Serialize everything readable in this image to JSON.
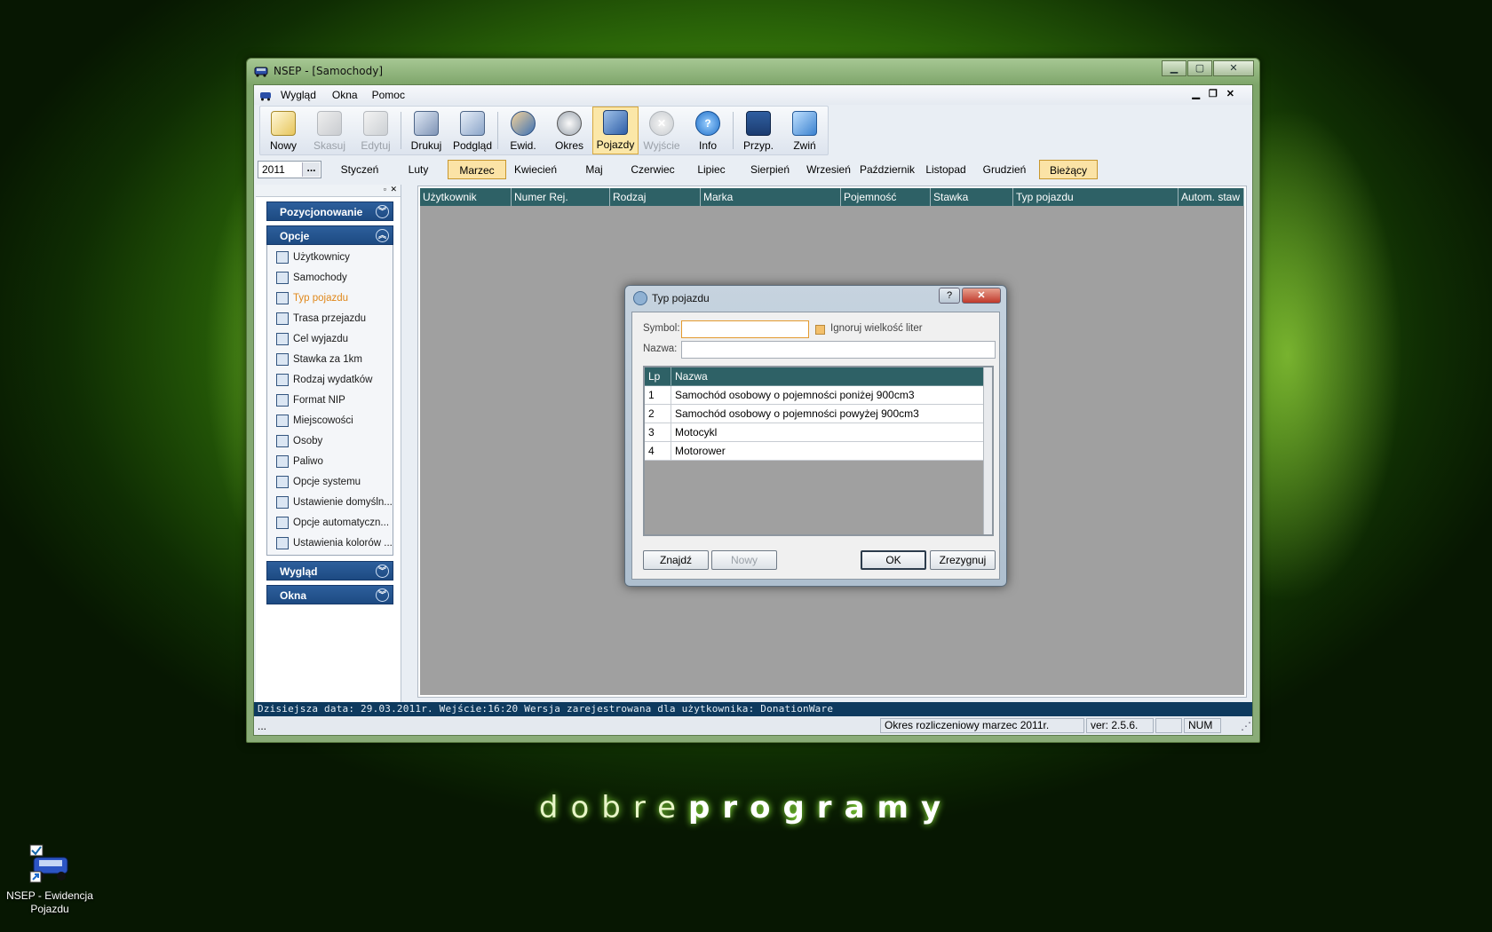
{
  "window": {
    "title": "NSEP - [Samochody]",
    "min": "▁",
    "max": "▢",
    "close": "✕"
  },
  "menu": {
    "items": [
      "Wygląd",
      "Okna",
      "Pomoc"
    ],
    "mdi_min": "▁",
    "mdi_restore": "❐",
    "mdi_close": "✕"
  },
  "toolbar": [
    {
      "label": "Nowy",
      "icon": "new-icon",
      "enabled": true
    },
    {
      "label": "Skasuj",
      "icon": "delete-icon",
      "enabled": false
    },
    {
      "label": "Edytuj",
      "icon": "edit-icon",
      "enabled": false
    },
    {
      "label": "Drukuj",
      "icon": "print-icon",
      "enabled": true
    },
    {
      "label": "Podgląd",
      "icon": "preview-icon",
      "enabled": true
    },
    {
      "label": "Ewid.",
      "icon": "users-icon",
      "enabled": true
    },
    {
      "label": "Okres",
      "icon": "clock-icon",
      "enabled": true
    },
    {
      "label": "Pojazdy",
      "icon": "vehicle-icon",
      "enabled": true,
      "active": true
    },
    {
      "label": "Wyjście",
      "icon": "exit-icon",
      "enabled": false
    },
    {
      "label": "Info",
      "icon": "info-icon",
      "enabled": true
    },
    {
      "label": "Przyp.",
      "icon": "reminder-icon",
      "enabled": true
    },
    {
      "label": "Zwiń",
      "icon": "collapse-icon",
      "enabled": true
    }
  ],
  "period": {
    "year": "2011",
    "browse": "...",
    "months": [
      "Styczeń",
      "Luty",
      "Marzec",
      "Kwiecień",
      "Maj",
      "Czerwiec",
      "Lipiec",
      "Sierpień",
      "Wrzesień",
      "Październik",
      "Listopad",
      "Grudzień"
    ],
    "selected_month": "Marzec",
    "current_label": "Bieżący"
  },
  "sidebar": {
    "pin": "▫",
    "close": "✕",
    "groups": {
      "positioning": "Pozycjonowanie",
      "options": "Opcje",
      "view": "Wygląd",
      "windows": "Okna"
    },
    "items": [
      "Użytkownicy",
      "Samochody",
      "Typ pojazdu",
      "Trasa przejazdu",
      "Cel wyjazdu",
      "Stawka za 1km",
      "Rodzaj wydatków",
      "Format NIP",
      "Miejscowości",
      "Osoby",
      "Paliwo",
      "Opcje systemu",
      "Ustawienie domyśln...",
      "Opcje automatyczn...",
      "Ustawienia kolorów ..."
    ],
    "current_item": "Typ pojazdu"
  },
  "grid": {
    "columns": [
      "Użytkownik",
      "Numer Rej.",
      "Rodzaj",
      "Marka",
      "Pojemność",
      "Stawka",
      "Typ pojazdu",
      "Autom. staw"
    ]
  },
  "infobar": {
    "text": "Dzisiejsza data: 29.03.2011r.  Wejście:16:20  Wersja zarejestrowana dla użytkownika: DonationWare"
  },
  "statusbar": {
    "left": "...",
    "period": "Okres rozliczeniowy marzec 2011r.",
    "version": "ver: 2.5.6.",
    "num": "NUM",
    "grip": "⋰"
  },
  "dialog": {
    "title": "Typ pojazdu",
    "help": "?",
    "close": "✕",
    "symbol_label": "Symbol:",
    "symbol_value": "",
    "ignore_case_label": "Ignoruj wielkość liter",
    "ignore_case_checked": true,
    "name_label": "Nazwa:",
    "name_value": "",
    "table": {
      "headers": [
        "Lp",
        "Nazwa"
      ],
      "rows": [
        [
          "1",
          "Samochód osobowy o pojemności poniżej 900cm3"
        ],
        [
          "2",
          "Samochód osobowy o pojemności powyżej 900cm3"
        ],
        [
          "3",
          "Motocykl"
        ],
        [
          "4",
          "Motorower"
        ]
      ]
    },
    "buttons": {
      "find": "Znajdź",
      "new": "Nowy",
      "ok": "OK",
      "cancel": "Zrezygnuj"
    }
  },
  "desktop": {
    "icon_label_line1": "NSEP - Ewidencja",
    "icon_label_line2": "Pojazdu",
    "brand_light": "dobre",
    "brand_bold": "programy"
  },
  "colors": {
    "grid_header": "#2e6166",
    "accent_selected": "#fbe3a6",
    "sidebar_group": "#1d4a82",
    "infobar": "#0e3a5e"
  }
}
